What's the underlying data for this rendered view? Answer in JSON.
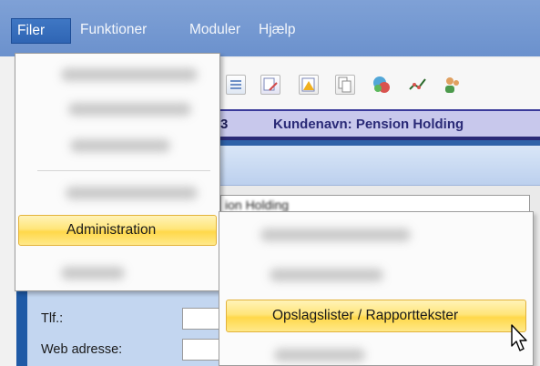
{
  "menubar": {
    "items": [
      {
        "label": "Filer"
      },
      {
        "label": "Funktioner"
      },
      {
        "label": "Moduler"
      },
      {
        "label": "Hjælp"
      }
    ]
  },
  "infobar": {
    "number_fragment": "3",
    "customer_label": "Kundenavn:  Pension Holding"
  },
  "customer_field": {
    "value_fragment": "ion Holding"
  },
  "file_menu": {
    "selected_label": "Administration"
  },
  "submenu": {
    "selected_label": "Opslagslister / Rapporttekster"
  },
  "form": {
    "phone_label": "Tlf.:",
    "web_label": "Web adresse:"
  },
  "colors": {
    "menubar": "#6b91cd",
    "highlight": "#ffe57a",
    "infobar": "#c8c8ec"
  },
  "icons": [
    "list-icon",
    "edit-icon",
    "warning-icon",
    "copy-icon",
    "globe-icon",
    "chart-icon",
    "users-icon"
  ]
}
